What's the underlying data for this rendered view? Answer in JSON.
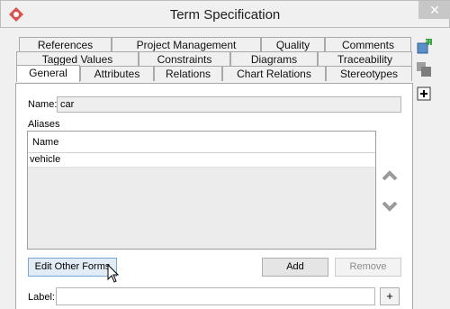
{
  "window": {
    "title": "Term Specification",
    "close_label": "✕"
  },
  "tabs_row1": [
    {
      "label": "References"
    },
    {
      "label": "Project Management"
    },
    {
      "label": "Quality"
    },
    {
      "label": "Comments"
    }
  ],
  "tabs_row2": [
    {
      "label": "Tagged Values"
    },
    {
      "label": "Constraints"
    },
    {
      "label": "Diagrams"
    },
    {
      "label": "Traceability"
    }
  ],
  "tabs_row3": [
    {
      "label": "General",
      "active": true
    },
    {
      "label": "Attributes"
    },
    {
      "label": "Relations"
    },
    {
      "label": "Chart Relations"
    },
    {
      "label": "Stereotypes"
    }
  ],
  "general": {
    "name_label": "Name:",
    "name_value": "car",
    "aliases_label": "Aliases",
    "aliases_column": "Name",
    "aliases_rows": [
      "vehicle"
    ],
    "edit_other_forms_label": "Edit Other Forms",
    "add_label": "Add",
    "remove_label": "Remove",
    "label_label": "Label:",
    "label_value": "",
    "plus_label": "+"
  },
  "colors": {
    "accent_red": "#d9534f",
    "focus_blue": "#7aa7d8",
    "arrow_gray": "#9a9a9a"
  },
  "icons": [
    "app-logo-icon",
    "move-up-icon",
    "move-down-icon",
    "mouse-cursor-icon",
    "add-element-icon",
    "duplicate-icon",
    "expand-icon"
  ]
}
